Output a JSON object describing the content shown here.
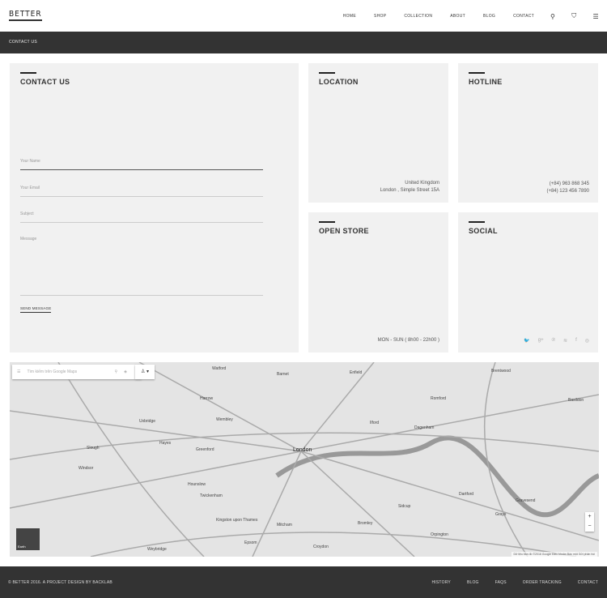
{
  "header": {
    "logo": "BETTER",
    "nav": [
      "HOME",
      "SHOP",
      "COLLECTION",
      "ABOUT",
      "BLOG",
      "CONTACT"
    ],
    "icons": [
      "search-icon",
      "cart-icon",
      "menu-icon"
    ]
  },
  "page_title": "CONTACT US",
  "contact": {
    "title": "CONTACT US",
    "fields": [
      "Your Name",
      "Your Email",
      "Subject",
      "Message"
    ],
    "send": "SEND MESSAGE"
  },
  "location": {
    "title": "LOCATION",
    "line1": "United Kingdom",
    "line2": "London , Simple Street 15A"
  },
  "hotline": {
    "title": "HOTLINE",
    "line1": "(+84) 963 868 345",
    "line2": "(+84) 123 456 7890"
  },
  "open_store": {
    "title": "OPEN STORE",
    "hours": "MON - SUN ( 8h00 - 22h00 )"
  },
  "social": {
    "title": "SOCIAL",
    "icons": [
      "twitter-icon",
      "google-plus-icon",
      "pinterest-icon",
      "rss-icon",
      "facebook-icon",
      "dribbble-icon"
    ],
    "glyphs": [
      "🐦",
      "g+",
      "℗",
      "≋",
      "f",
      "◎"
    ]
  },
  "map": {
    "search_placeholder": "Tìm kiếm trên Google Maps",
    "earth": "Earth",
    "attribution": "Dữ liệu bản đồ ©2016 Google   Điều khoản   Báo một   Gửi phản hồi",
    "places": [
      "London",
      "Harrow",
      "Wembley",
      "Slough",
      "Windsor",
      "Romford",
      "Dagenham",
      "Basildon",
      "Brentwood",
      "Ilford",
      "Croydon",
      "Bromley",
      "Dartford",
      "Gravesend",
      "Mitcham",
      "Twickenham",
      "Hounslow",
      "Kingston upon Thames",
      "Weybridge",
      "Epsom",
      "Greenford",
      "Hayes",
      "Uxbridge",
      "Grays",
      "Orpington",
      "Sidcup",
      "Enfield",
      "Barnet",
      "Watford"
    ]
  },
  "footer": {
    "copyright": "© BETTER 2016. A PROJECT DESIGN BY BACKLAB",
    "links": [
      "HISTORY",
      "BLOG",
      "FAQS",
      "ORDER TRACKING",
      "CONTACT"
    ]
  }
}
